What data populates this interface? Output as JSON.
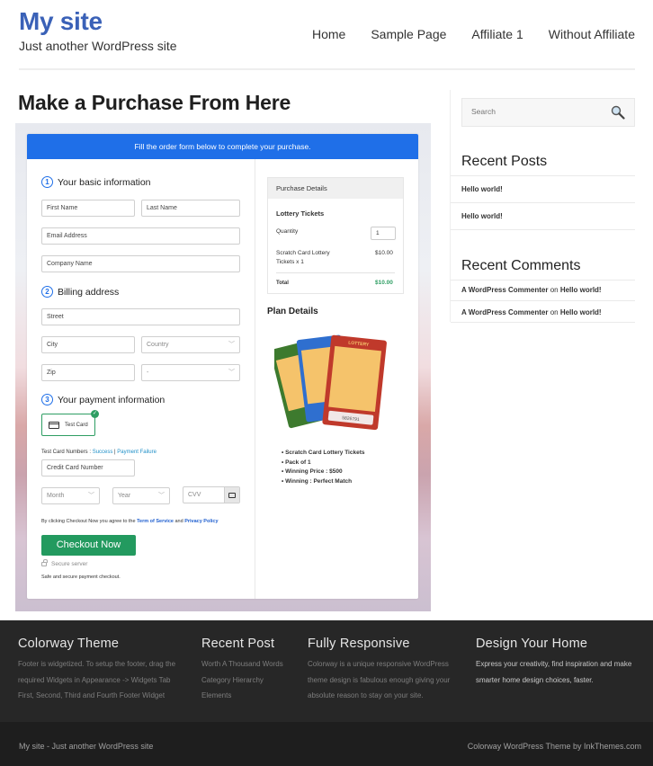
{
  "header": {
    "site_title": "My site",
    "tagline": "Just another WordPress site",
    "nav": [
      "Home",
      "Sample Page",
      "Affiliate 1",
      "Without Affiliate"
    ]
  },
  "page": {
    "title": "Make a Purchase From Here"
  },
  "form": {
    "banner": "Fill the order form below to complete your purchase.",
    "steps": [
      {
        "num": "1",
        "label": "Your basic information"
      },
      {
        "num": "2",
        "label": "Billing address"
      },
      {
        "num": "3",
        "label": "Your payment information"
      }
    ],
    "fields": {
      "first_name": "First Name",
      "last_name": "Last Name",
      "email": "Email Address",
      "company": "Company Name",
      "street": "Street",
      "city": "City",
      "country": "Country",
      "zip": "Zip",
      "state": "-",
      "card_number": "Credit Card Number",
      "month": "Month",
      "year": "Year",
      "cvv": "CVV"
    },
    "payment_option": "Test Card",
    "test_cards_label": "Test Card Numbers : ",
    "test_success": "Success",
    "test_sep": " | ",
    "test_failure": "Payment Failure",
    "agree_prefix": "By clicking Checkout Now you agree to the ",
    "terms": "Term of Service",
    "agree_and": " and ",
    "privacy": "Privacy Policy",
    "checkout_button": "Checkout Now",
    "secure_server": "Secure server",
    "safe_text": "Safe and secure payment checkout."
  },
  "purchase": {
    "heading": "Purchase Details",
    "product": "Lottery Tickets",
    "quantity_label": "Quantity",
    "quantity_value": "1",
    "line_item_1": "Scratch Card Lottery",
    "line_item_2": "Tickets x 1",
    "line_price": "$10.00",
    "total_label": "Total",
    "total_value": "$10.00",
    "total_color": "#2e9e63"
  },
  "plan": {
    "title": "Plan Details",
    "ticket_serial": "5826791",
    "ticket_label": "LOTTERY",
    "features": [
      "Scratch Card Lottery Tickets",
      "Pack of 1",
      "Winning Price : $500",
      "Winning : Perfect Match"
    ]
  },
  "sidebar": {
    "search_placeholder": "Search",
    "recent_posts_title": "Recent Posts",
    "recent_posts": [
      "Hello world!",
      "Hello world!"
    ],
    "recent_comments_title": "Recent Comments",
    "recent_comments": [
      {
        "author": "A WordPress Commenter",
        "on": " on ",
        "post": "Hello world!"
      },
      {
        "author": "A WordPress Commenter",
        "on": " on ",
        "post": "Hello world!"
      }
    ]
  },
  "footer": {
    "columns": [
      {
        "title": "Colorway Theme",
        "text": [
          "Footer is widgetized. To setup the footer, drag the",
          "required Widgets in Appearance -> Widgets Tab",
          "First, Second, Third and Fourth Footer Widget"
        ]
      },
      {
        "title": "Recent Post",
        "links": [
          "Worth A Thousand Words",
          "Category Hierarchy",
          "Elements"
        ]
      },
      {
        "title": "Fully Responsive",
        "text": [
          "Colorway is a unique responsive WordPress",
          "theme design is fabulous enough giving your",
          "absolute reason to stay on your site."
        ]
      },
      {
        "title": "Design Your Home",
        "text": [
          "Express your creativity, find inspiration and make",
          "smarter home design choices, faster."
        ]
      }
    ],
    "bottom_left": "My site - Just another WordPress site",
    "bottom_right": "Colorway WordPress Theme by InkThemes.com"
  },
  "colors": {
    "brand": "#3a61b7",
    "banner": "#1f6fe8",
    "checkout": "#239a5f",
    "footer_bg": "#272727"
  }
}
